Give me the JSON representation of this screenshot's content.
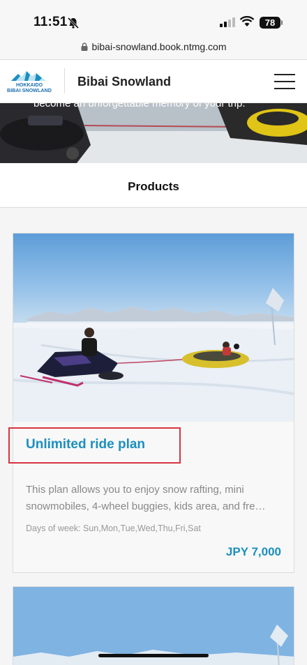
{
  "status_bar": {
    "time": "11:51",
    "battery": "78"
  },
  "browser": {
    "url": "bibai-snowland.book.ntmg.com"
  },
  "header": {
    "logo_line1": "HOKKAIDO",
    "logo_line2": "BIBAI SNOWLAND",
    "site_title": "Bibai Snowland"
  },
  "hero": {
    "text": "become an unforgettable memory of your trip."
  },
  "products": {
    "title": "Products"
  },
  "card": {
    "title": "Unlimited ride plan",
    "description": "This plan allows you to enjoy snow rafting, mini snowmobiles, 4-wheel buggies, kids area, and fre…",
    "days": "Days of week: Sun,Mon,Tue,Wed,Thu,Fri,Sat",
    "price": "JPY 7,000"
  },
  "colors": {
    "accent": "#1b8fc0",
    "highlight": "#d6343f"
  }
}
